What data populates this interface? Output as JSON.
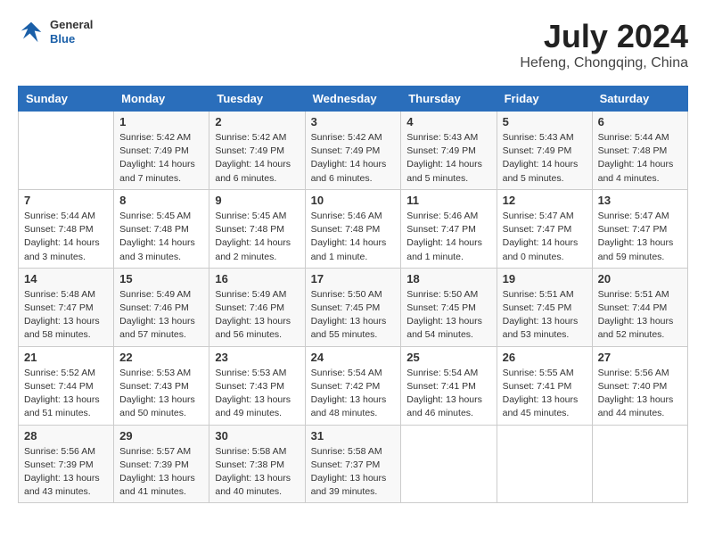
{
  "header": {
    "logo_general": "General",
    "logo_blue": "Blue",
    "month_year": "July 2024",
    "location": "Hefeng, Chongqing, China"
  },
  "columns": [
    "Sunday",
    "Monday",
    "Tuesday",
    "Wednesday",
    "Thursday",
    "Friday",
    "Saturday"
  ],
  "weeks": [
    [
      {
        "day": "",
        "info": ""
      },
      {
        "day": "1",
        "info": "Sunrise: 5:42 AM\nSunset: 7:49 PM\nDaylight: 14 hours\nand 7 minutes."
      },
      {
        "day": "2",
        "info": "Sunrise: 5:42 AM\nSunset: 7:49 PM\nDaylight: 14 hours\nand 6 minutes."
      },
      {
        "day": "3",
        "info": "Sunrise: 5:42 AM\nSunset: 7:49 PM\nDaylight: 14 hours\nand 6 minutes."
      },
      {
        "day": "4",
        "info": "Sunrise: 5:43 AM\nSunset: 7:49 PM\nDaylight: 14 hours\nand 5 minutes."
      },
      {
        "day": "5",
        "info": "Sunrise: 5:43 AM\nSunset: 7:49 PM\nDaylight: 14 hours\nand 5 minutes."
      },
      {
        "day": "6",
        "info": "Sunrise: 5:44 AM\nSunset: 7:48 PM\nDaylight: 14 hours\nand 4 minutes."
      }
    ],
    [
      {
        "day": "7",
        "info": "Sunrise: 5:44 AM\nSunset: 7:48 PM\nDaylight: 14 hours\nand 3 minutes."
      },
      {
        "day": "8",
        "info": "Sunrise: 5:45 AM\nSunset: 7:48 PM\nDaylight: 14 hours\nand 3 minutes."
      },
      {
        "day": "9",
        "info": "Sunrise: 5:45 AM\nSunset: 7:48 PM\nDaylight: 14 hours\nand 2 minutes."
      },
      {
        "day": "10",
        "info": "Sunrise: 5:46 AM\nSunset: 7:48 PM\nDaylight: 14 hours\nand 1 minute."
      },
      {
        "day": "11",
        "info": "Sunrise: 5:46 AM\nSunset: 7:47 PM\nDaylight: 14 hours\nand 1 minute."
      },
      {
        "day": "12",
        "info": "Sunrise: 5:47 AM\nSunset: 7:47 PM\nDaylight: 14 hours\nand 0 minutes."
      },
      {
        "day": "13",
        "info": "Sunrise: 5:47 AM\nSunset: 7:47 PM\nDaylight: 13 hours\nand 59 minutes."
      }
    ],
    [
      {
        "day": "14",
        "info": "Sunrise: 5:48 AM\nSunset: 7:47 PM\nDaylight: 13 hours\nand 58 minutes."
      },
      {
        "day": "15",
        "info": "Sunrise: 5:49 AM\nSunset: 7:46 PM\nDaylight: 13 hours\nand 57 minutes."
      },
      {
        "day": "16",
        "info": "Sunrise: 5:49 AM\nSunset: 7:46 PM\nDaylight: 13 hours\nand 56 minutes."
      },
      {
        "day": "17",
        "info": "Sunrise: 5:50 AM\nSunset: 7:45 PM\nDaylight: 13 hours\nand 55 minutes."
      },
      {
        "day": "18",
        "info": "Sunrise: 5:50 AM\nSunset: 7:45 PM\nDaylight: 13 hours\nand 54 minutes."
      },
      {
        "day": "19",
        "info": "Sunrise: 5:51 AM\nSunset: 7:45 PM\nDaylight: 13 hours\nand 53 minutes."
      },
      {
        "day": "20",
        "info": "Sunrise: 5:51 AM\nSunset: 7:44 PM\nDaylight: 13 hours\nand 52 minutes."
      }
    ],
    [
      {
        "day": "21",
        "info": "Sunrise: 5:52 AM\nSunset: 7:44 PM\nDaylight: 13 hours\nand 51 minutes."
      },
      {
        "day": "22",
        "info": "Sunrise: 5:53 AM\nSunset: 7:43 PM\nDaylight: 13 hours\nand 50 minutes."
      },
      {
        "day": "23",
        "info": "Sunrise: 5:53 AM\nSunset: 7:43 PM\nDaylight: 13 hours\nand 49 minutes."
      },
      {
        "day": "24",
        "info": "Sunrise: 5:54 AM\nSunset: 7:42 PM\nDaylight: 13 hours\nand 48 minutes."
      },
      {
        "day": "25",
        "info": "Sunrise: 5:54 AM\nSunset: 7:41 PM\nDaylight: 13 hours\nand 46 minutes."
      },
      {
        "day": "26",
        "info": "Sunrise: 5:55 AM\nSunset: 7:41 PM\nDaylight: 13 hours\nand 45 minutes."
      },
      {
        "day": "27",
        "info": "Sunrise: 5:56 AM\nSunset: 7:40 PM\nDaylight: 13 hours\nand 44 minutes."
      }
    ],
    [
      {
        "day": "28",
        "info": "Sunrise: 5:56 AM\nSunset: 7:39 PM\nDaylight: 13 hours\nand 43 minutes."
      },
      {
        "day": "29",
        "info": "Sunrise: 5:57 AM\nSunset: 7:39 PM\nDaylight: 13 hours\nand 41 minutes."
      },
      {
        "day": "30",
        "info": "Sunrise: 5:58 AM\nSunset: 7:38 PM\nDaylight: 13 hours\nand 40 minutes."
      },
      {
        "day": "31",
        "info": "Sunrise: 5:58 AM\nSunset: 7:37 PM\nDaylight: 13 hours\nand 39 minutes."
      },
      {
        "day": "",
        "info": ""
      },
      {
        "day": "",
        "info": ""
      },
      {
        "day": "",
        "info": ""
      }
    ]
  ]
}
